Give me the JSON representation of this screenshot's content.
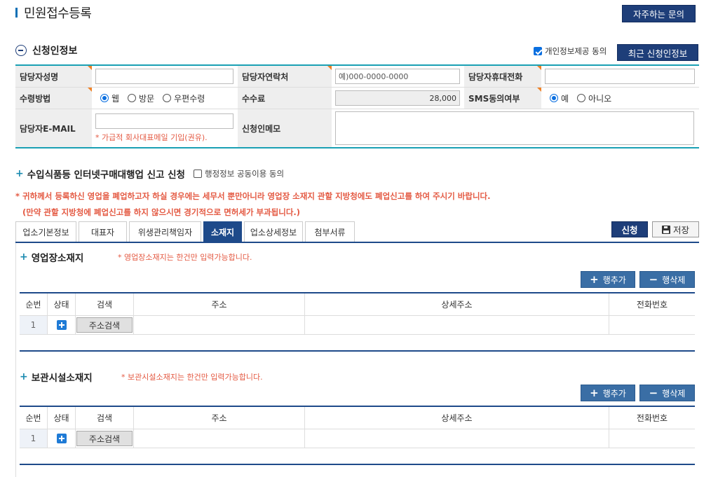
{
  "header": {
    "title": "민원접수등록",
    "faq_button": "자주하는 문의"
  },
  "applicant": {
    "section_title": "신청인정보",
    "privacy_consent_label": "개인정보제공 동의",
    "privacy_consent_checked": true,
    "recent_button": "최근 신청인정보",
    "labels": {
      "name": "담당자성명",
      "contact": "담당자연락처",
      "mobile": "담당자휴대전화",
      "receive_method": "수령방법",
      "fee": "수수료",
      "sms_consent": "SMS동의여부",
      "email": "담당자E-MAIL",
      "memo": "신청인메모"
    },
    "contact_placeholder": "예)000-0000-0000",
    "fee_value": "28,000",
    "receive_options": [
      "웹",
      "방문",
      "우편수령"
    ],
    "receive_selected": "웹",
    "sms_options": [
      "예",
      "아니오"
    ],
    "sms_selected": "예",
    "email_note": "* 가급적 회사대표메일 기입(권유)."
  },
  "report": {
    "title": "수입식품등 인터넷구매대행업 신고 신청",
    "consent_label": "행정정보 공동이용 동의",
    "consent_checked": false,
    "warning_line1": "* 귀하께서 등록하신 영업을 폐업하고자 하실 경우에는 세무서 뿐만아니라 영업장 소재지 관할 지방청에도 폐업신고를 하여 주시기 바랍니다.",
    "warning_line2": "(만약 관할 지방청에 폐업신고를 하지 않으시면 경기적으로 면허세가 부과됩니다.)"
  },
  "tabs": [
    {
      "label": "업소기본정보",
      "active": false
    },
    {
      "label": "대표자",
      "active": false
    },
    {
      "label": "위생관리책임자",
      "active": false
    },
    {
      "label": "소재지",
      "active": true
    },
    {
      "label": "업소상세정보",
      "active": false
    },
    {
      "label": "첨부서류",
      "active": false
    }
  ],
  "actions": {
    "apply": "신청",
    "save": "저장"
  },
  "business_location": {
    "title": "영업장소재지",
    "note": "* 영업장소재지는 한건만 입력가능합니다.",
    "add_row": "행추가",
    "delete_row": "행삭제"
  },
  "storage_location": {
    "title": "보관시설소재지",
    "note": "* 보관시설소재지는 한건만 입력가능합니다.",
    "add_row": "행추가",
    "delete_row": "행삭제"
  },
  "grid": {
    "columns": [
      "순번",
      "상태",
      "검색",
      "주소",
      "상세주소",
      "전화번호"
    ],
    "row_number": "1",
    "address_search_button": "주소검색"
  }
}
